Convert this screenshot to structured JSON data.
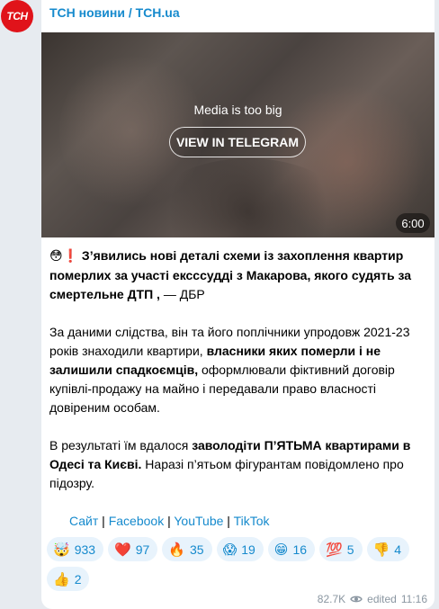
{
  "channel": {
    "avatar_text": "ТСН",
    "name": "ТСН новини / TCH.ua"
  },
  "media": {
    "message": "Media is too big",
    "button_label": "VIEW IN TELEGRAM",
    "duration": "6:00"
  },
  "post": {
    "p1_emoji": "😳❗",
    "p1_bold": "З’явились нові деталі схеми із захоплення квартир померлих за участі ексссудді з Макарова, якого судять за смертельне ДТП ,",
    "p1_tail": " — ДБР",
    "p2_a": "За даними слідства, він та його поплічники упродовж 2021-23 років знаходили квартири, ",
    "p2_bold": "власники яких померли і не залишили спадкоємців,",
    "p2_b": " оформлювали фіктивний договір купівлі-продажу на майно і передавали право власності довіреним особам.",
    "p3_a": "В результаті їм вдалося ",
    "p3_bold": "заволодіти П’ЯТЬМА квартирами в Одесі та Києві.",
    "p3_b": " Наразі п’ятьом фігурантам повідомлено про підозру."
  },
  "links": [
    {
      "label": "Сайт"
    },
    {
      "label": "Facebook"
    },
    {
      "label": "YouTube"
    },
    {
      "label": "TikTok"
    }
  ],
  "link_separator": " | ",
  "reactions": [
    {
      "emoji": "🤯",
      "count": "933"
    },
    {
      "emoji": "❤️",
      "count": "97"
    },
    {
      "emoji": "🔥",
      "count": "35"
    },
    {
      "emoji": "😱",
      "count": "19"
    },
    {
      "emoji": "😁",
      "count": "16"
    },
    {
      "emoji": "💯",
      "count": "5"
    },
    {
      "emoji": "👎",
      "count": "4"
    },
    {
      "emoji": "👍",
      "count": "2"
    }
  ],
  "meta": {
    "views": "82.7K",
    "edited": "edited",
    "time": "11:16"
  },
  "colors": {
    "link": "#168acd",
    "background": "#e7ebf0",
    "avatar": "#e0131a"
  }
}
